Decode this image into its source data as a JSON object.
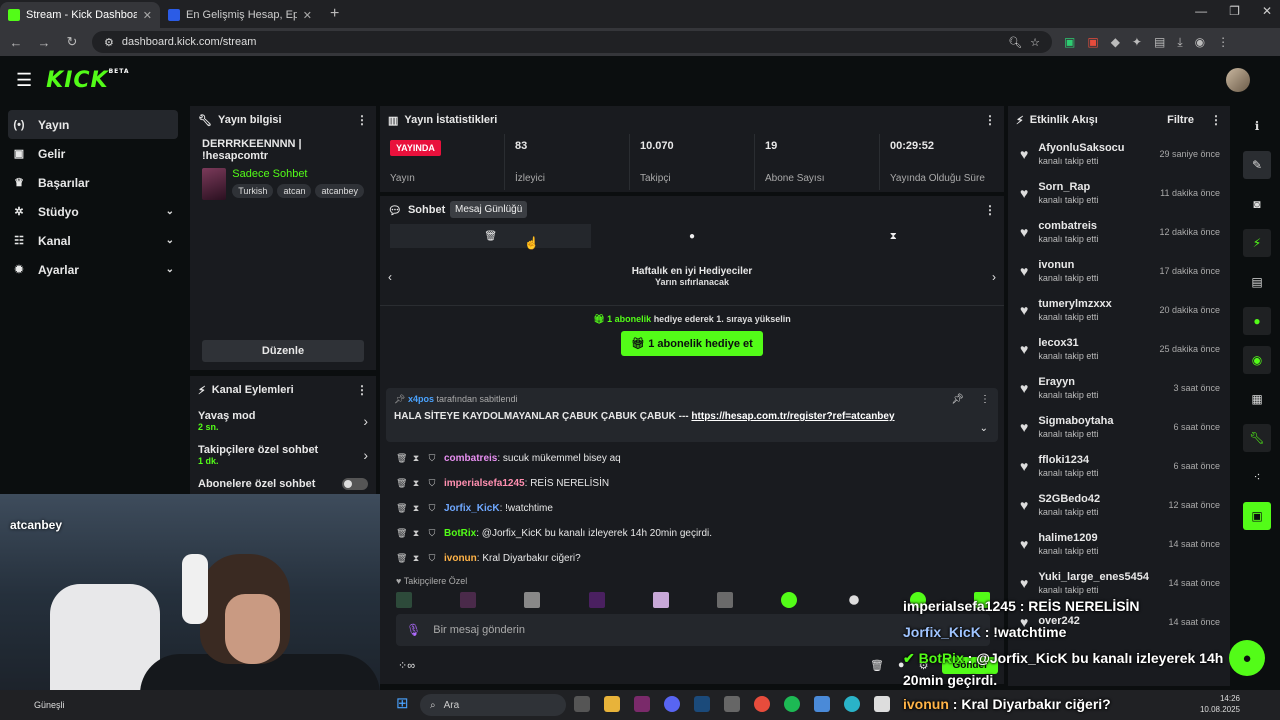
{
  "browser": {
    "tabs": [
      {
        "title": "Stream - Kick Dashboard",
        "favcolor": "#53fc18",
        "active": true
      },
      {
        "title": "En Gelişmiş Hesap, Epin ve İtem",
        "favcolor": "#2b5ce6",
        "active": false
      }
    ],
    "url": "dashboard.kick.com/stream",
    "date_widget_text": ""
  },
  "header": {
    "logo": "KICK",
    "logo_sup": "BETA"
  },
  "nav": [
    {
      "label": "Yayın",
      "icon": "broadcast-icon",
      "glyph": "(•)",
      "active": true,
      "chevron": false
    },
    {
      "label": "Gelir",
      "icon": "revenue-icon",
      "glyph": "▣",
      "active": false,
      "chevron": false
    },
    {
      "label": "Başarılar",
      "icon": "trophy-icon",
      "glyph": "♛",
      "active": false,
      "chevron": false
    },
    {
      "label": "Stüdyo",
      "icon": "studio-icon",
      "glyph": "✲",
      "active": false,
      "chevron": true
    },
    {
      "label": "Kanal",
      "icon": "channel-icon",
      "glyph": "☷",
      "active": false,
      "chevron": true
    },
    {
      "label": "Ayarlar",
      "icon": "settings-icon",
      "glyph": "✹",
      "active": false,
      "chevron": true
    }
  ],
  "stream_info": {
    "header": "Yayın bilgisi",
    "title": "DERRRKEENNNN | !hesapcomtr",
    "category": "Sadece Sohbet",
    "tags": [
      "Turkish",
      "atcan",
      "atcanbey"
    ],
    "edit_label": "Düzenle"
  },
  "channel_actions": {
    "header": "Kanal Eylemleri",
    "items": [
      {
        "label": "Yavaş mod",
        "sub": "2 sn."
      },
      {
        "label": "Takipçilere özel sohbet",
        "sub": "1 dk."
      },
      {
        "label": "Abonelere özel sohbet",
        "sub": ""
      }
    ]
  },
  "stats": {
    "header": "Yayın İstatistikleri",
    "live_badge": "YAYINDA",
    "items": [
      {
        "value": "",
        "label": "Yayın"
      },
      {
        "value": "83",
        "label": "İzleyici"
      },
      {
        "value": "10.070",
        "label": "Takipçi"
      },
      {
        "value": "19",
        "label": "Abone Sayısı"
      },
      {
        "value": "00:29:52",
        "label": "Yayında Olduğu Süre"
      }
    ]
  },
  "chat": {
    "header": "Sohbet",
    "tooltip": "Mesaj Günlüğü",
    "gifters_title": "Haftalık en iyi Hediyeciler",
    "gifters_sub": "Yarın sıfırlanacak",
    "promo_bold": "1 abonelik",
    "promo_rest": " hediye ederek 1. sıraya yükselin",
    "gift_button": "1 abonelik hediye et",
    "pinned": {
      "by_user": "x4pos",
      "by_rest": " tarafından sabitlendi",
      "text": "HALA SİTEYE KAYDOLMAYANLAR ÇABUK ÇABUK ÇABUK --- ",
      "link": "https://hesap.com.tr/register?ref=atcanbey"
    },
    "messages": [
      {
        "user": "combatreis",
        "color": "#e78ff0",
        "text": "sucuk mükemmel bisey aq"
      },
      {
        "user": "imperialsefa1245",
        "color": "#ff8fb0",
        "text": "REİS NERELİSİN"
      },
      {
        "user": "Jorfix_KicK",
        "color": "#6fa8ff",
        "text": "!watchtime"
      },
      {
        "user": "BotRix",
        "color": "#53fc18",
        "text": "@Jorfix_KicK bu kanalı izleyerek 14h 20min geçirdi."
      },
      {
        "user": "ivonun",
        "color": "#ffb347",
        "text": "Kral Diyarbakır ciğeri?"
      }
    ],
    "subonly_label": "Takipçilere Özel",
    "input_placeholder": "Bir mesaj gönderin",
    "send_label": "Gönder"
  },
  "activity": {
    "header": "Etkinlik Akışı",
    "filter_label": "Filtre",
    "items": [
      {
        "name": "AfyonluSaksocu",
        "desc": "kanalı takip etti",
        "time": "29 saniye önce"
      },
      {
        "name": "Sorn_Rap",
        "desc": "kanalı takip etti",
        "time": "11 dakika önce"
      },
      {
        "name": "combatreis",
        "desc": "kanalı takip etti",
        "time": "12 dakika önce"
      },
      {
        "name": "ivonun",
        "desc": "kanalı takip etti",
        "time": "17 dakika önce"
      },
      {
        "name": "tumerylmzxxx",
        "desc": "kanalı takip etti",
        "time": "20 dakika önce"
      },
      {
        "name": "lecox31",
        "desc": "kanalı takip etti",
        "time": "25 dakika önce"
      },
      {
        "name": "Erayyn",
        "desc": "kanalı takip etti",
        "time": "3 saat önce"
      },
      {
        "name": "Sigmaboytaha",
        "desc": "kanalı takip etti",
        "time": "6 saat önce"
      },
      {
        "name": "ffloki1234",
        "desc": "kanalı takip etti",
        "time": "6 saat önce"
      },
      {
        "name": "S2GBedo42",
        "desc": "kanalı takip etti",
        "time": "12 saat önce"
      },
      {
        "name": "halime1209",
        "desc": "kanalı takip etti",
        "time": "14 saat önce"
      },
      {
        "name": "Yuki_large_enes5454",
        "desc": "kanalı takip etti",
        "time": "14 saat önce"
      },
      {
        "name": "over242",
        "desc": "",
        "time": "14 saat önce"
      }
    ]
  },
  "webcam": {
    "name": "atcanbey"
  },
  "overlay": [
    {
      "user": "imperialsefa1245",
      "text": " : REİS NERELİSİN"
    },
    {
      "user": "Jorfix_KicK",
      "text": " : !watchtime"
    },
    {
      "user": "BotRix",
      "text": " : @Jorfix_KicK bu kanalı izleyerek 14h"
    },
    {
      "user": "",
      "text": "20min geçirdi."
    },
    {
      "user": "ivonun",
      "text": " : Kral Diyarbakır ciğeri?"
    }
  ],
  "taskbar": {
    "weather": "Güneşli",
    "search": "Ara",
    "time": "14:26",
    "date": "10.08.2025"
  },
  "colors": {
    "accent": "#53fc18",
    "live": "#e9113c",
    "panel": "#191b1f",
    "bg": "#0b0e0f"
  }
}
